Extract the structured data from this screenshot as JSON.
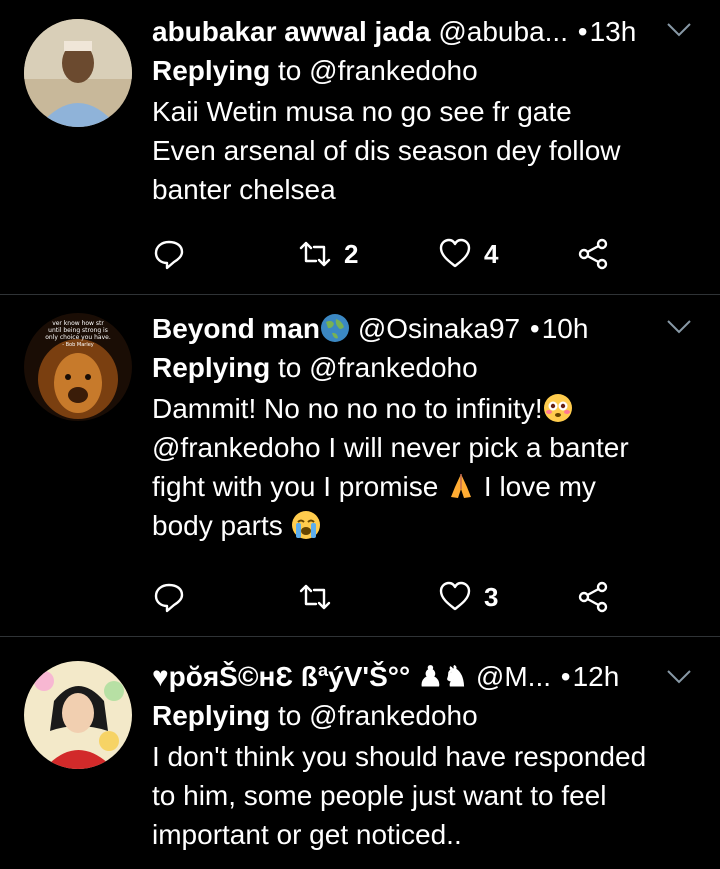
{
  "tweets": [
    {
      "name": "abubakar awwal jada",
      "handle": "@abuba...",
      "time": "13h",
      "replying_label": "Replying",
      "replying_to": "to @frankedoho",
      "lines": [
        "Kaii Wetin musa no go see fr gate",
        "Even arsenal of dis season dey follow",
        "banter chelsea"
      ],
      "retweets": "2",
      "likes": "4"
    },
    {
      "name": "Beyond man",
      "handle": "@Osinaka97",
      "time": "10h",
      "replying_label": "Replying",
      "replying_to": "to @frankedoho",
      "lines": [
        "Dammit! No no no no to infinity!",
        "@frankedoho I will never pick a banter",
        "fight with you I promise",
        " I love my",
        "body parts "
      ],
      "retweets": "",
      "likes": "3",
      "avatar_text": [
        "ver know how str",
        "until being strong is",
        "only choice you have.",
        "- Bob Marley"
      ]
    },
    {
      "name": "♥pŏяŠ©нƐ ßªýV'Š°° ♟♞",
      "handle": "@M...",
      "time": "12h",
      "replying_label": "Replying",
      "replying_to": "to @frankedoho",
      "lines": [
        "I don't think you should have responded",
        "to him, some people just want to feel",
        "important or get noticed.."
      ]
    }
  ],
  "icons": [
    "reply-icon",
    "retweet-icon",
    "like-icon",
    "share-icon",
    "caret-down-icon",
    "globe-emoji",
    "flushed-emoji",
    "pray-emoji",
    "crying-emoji"
  ]
}
